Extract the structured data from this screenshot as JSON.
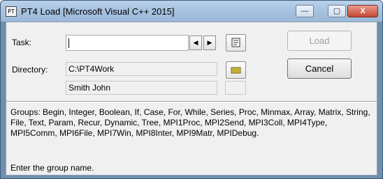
{
  "window": {
    "title": "PT4 Load [Microsoft Visual C++ 2015]",
    "icon_text": "PT"
  },
  "task": {
    "label": "Task:",
    "value": ""
  },
  "directory": {
    "label": "Directory:",
    "path": "C:\\PT4Work",
    "user": "Smith John"
  },
  "buttons": {
    "load": "Load",
    "cancel": "Cancel"
  },
  "window_controls": {
    "minimize": "—",
    "maximize": "▢",
    "close": "X"
  },
  "spin": {
    "left": "◀",
    "right": "▶"
  },
  "info": {
    "groups_text": "Groups: Begin, Integer, Boolean, If, Case, For, While, Series, Proc, Minmax, Array, Matrix, String, File, Text, Param, Recur, Dynamic, Tree, MPI1Proc, MPI2Send, MPI3Coll, MPI4Type, MPI5Comm, MPI6File, MPI7Win, MPI8Inter, MPI9Matr, MPIDebug.",
    "hint": "Enter the group name."
  },
  "icons": {
    "task_tool": "task-list-icon",
    "directory_tool": "folder-icon"
  },
  "colors": {
    "disabled_text": "#a0a0a0",
    "titlebar": "#a7c3e0"
  }
}
